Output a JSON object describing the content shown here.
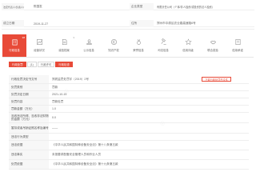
{
  "header": {
    "row1": {
      "label1": "法定代表人/负责人/执行事务合伙人",
      "value1": "陈国发",
      "label2": "企业类型",
      "value2": "有限责任公司（个体/非人独资/或投资的法人独资）"
    },
    "row2": {
      "label1": "成立日期",
      "value1": "2019-11-27",
      "label2": "住所",
      "value2": "郑州市中原区农业路高速路6号"
    }
  },
  "tabs": [
    {
      "label": "行政信息",
      "count": "38",
      "active": true,
      "icon": "building-icon"
    },
    {
      "label": "经营状况",
      "count": "",
      "active": false,
      "icon": "chart-icon"
    },
    {
      "label": "诚信档案",
      "count": "3",
      "active": false,
      "icon": "document-icon"
    },
    {
      "label": "公示信息",
      "count": "",
      "active": false,
      "icon": "stamp-icon"
    },
    {
      "label": "知识产权",
      "count": "",
      "active": false,
      "icon": "copyright-icon"
    },
    {
      "label": "荣誉信息",
      "count": "",
      "active": false,
      "icon": "medal-icon"
    },
    {
      "label": "司法信息",
      "count": "",
      "active": false,
      "icon": "gavel-icon"
    },
    {
      "label": "信用评级",
      "count": "",
      "active": false,
      "icon": "star-icon"
    },
    {
      "label": "联合奖惩",
      "count": "",
      "active": false,
      "icon": "handshake-icon"
    },
    {
      "label": "信用承诺",
      "count": "",
      "active": false,
      "icon": "pen-icon"
    }
  ],
  "subtabs": [
    {
      "label": "行政处罚",
      "active": true
    },
    {
      "label": "(1)",
      "active": false
    },
    {
      "label": "行政许可",
      "active": false
    },
    {
      "label": "行政检查",
      "active": true
    }
  ],
  "detail": {
    "rows": [
      {
        "label": "行政处罚决定书文号",
        "value": "郑质监罚处罚字〔2019〕2号",
        "height": 11,
        "button": "下载行政处罚书文件"
      },
      {
        "label": "处罚类别",
        "value": "罚款",
        "height": 9
      },
      {
        "label": "处罚决定日期",
        "value": "2021-10-15",
        "height": 9
      },
      {
        "label": "处罚内容",
        "value": "罚款处罚",
        "height": 9
      },
      {
        "label": "罚款金额（万元）",
        "value": "1.0",
        "height": 9
      },
      {
        "label": "没收违法所得、没收非法财物的金额（万元）",
        "value": "0.0",
        "height": 13
      },
      {
        "label": "暂扣或者吊销证照名称及编号",
        "value": "——",
        "height": 13
      },
      {
        "label": "违法行为类型",
        "value": "",
        "height": 9
      },
      {
        "label": "违法依据",
        "value": "《中华人民共和国特种设备安全法》第十八条第五款",
        "height": 12
      },
      {
        "label": "违法事实",
        "value": "未按要求配备安全管理人员和作业人员",
        "height": 12
      },
      {
        "label": "处罚依据",
        "value": "《中华人民共和国特种设备安全法》第十九条第五款",
        "height": 12
      }
    ]
  },
  "colors": {
    "accent": "#e84a38"
  }
}
